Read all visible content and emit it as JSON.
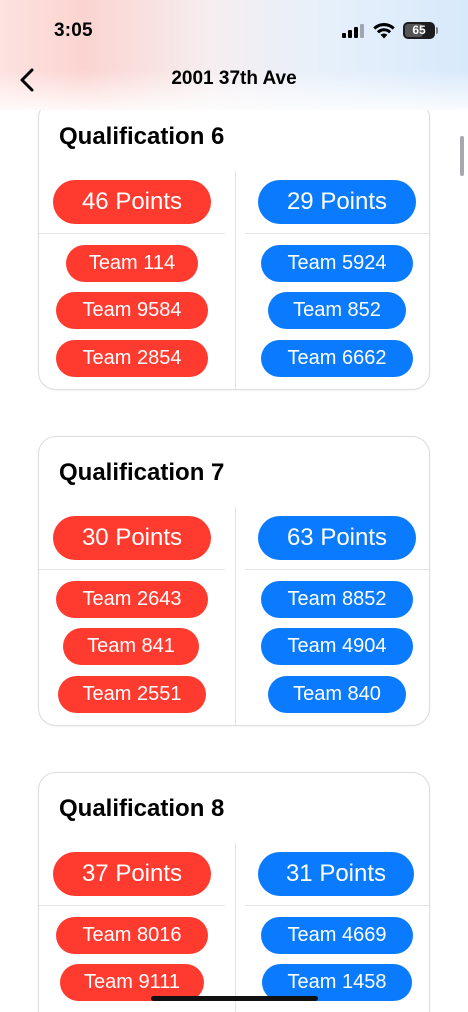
{
  "status_bar": {
    "time": "3:05",
    "battery_level": "65"
  },
  "nav": {
    "title": "2001 37th Ave"
  },
  "colors": {
    "red_alliance": "#ff3b30",
    "blue_alliance": "#0a7bff"
  },
  "matches": [
    {
      "title": "Qualification 6",
      "red": {
        "points": "46 Points",
        "teams": [
          "Team 114",
          "Team 9584",
          "Team 2854"
        ]
      },
      "blue": {
        "points": "29 Points",
        "teams": [
          "Team 5924",
          "Team 852",
          "Team 6662"
        ]
      }
    },
    {
      "title": "Qualification 7",
      "red": {
        "points": "30 Points",
        "teams": [
          "Team 2643",
          "Team 841",
          "Team 2551"
        ]
      },
      "blue": {
        "points": "63 Points",
        "teams": [
          "Team 8852",
          "Team 4904",
          "Team 840"
        ]
      }
    },
    {
      "title": "Qualification 8",
      "red": {
        "points": "37 Points",
        "teams": [
          "Team 8016",
          "Team 9111",
          ""
        ]
      },
      "blue": {
        "points": "31 Points",
        "teams": [
          "Team 4669",
          "Team 1458",
          ""
        ]
      }
    }
  ],
  "icons": {
    "back": "chevron-left-icon",
    "signal": "cellular-signal-icon",
    "wifi": "wifi-icon",
    "battery": "battery-icon"
  }
}
